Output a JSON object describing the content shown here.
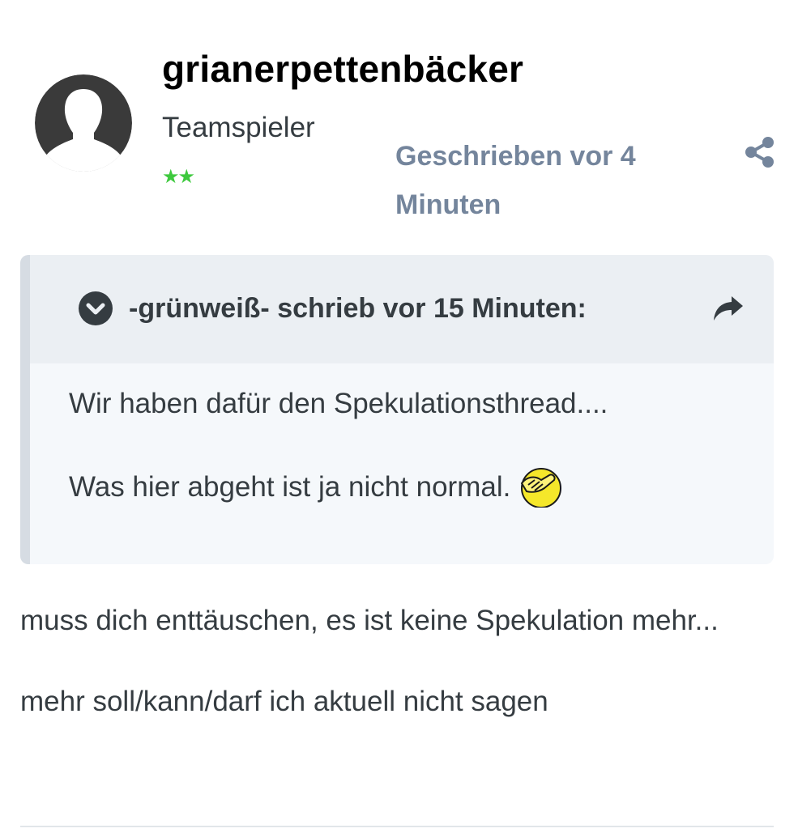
{
  "author": {
    "name": "grianerpettenbäcker",
    "rank": "Teamspieler",
    "stars": "★★",
    "avatar_icon": "user-silhouette-icon"
  },
  "post": {
    "date": "Geschrieben vor 4 Minuten",
    "share_icon": "share-icon",
    "paragraphs": [
      "muss dich enttäuschen, es ist keine Spekulation mehr...",
      "mehr soll/kann/darf ich aktuell nicht sagen"
    ]
  },
  "quote": {
    "citation": "-grünweiß- schrieb vor 15 Minuten:",
    "toggle_icon": "chevron-down-circle-icon",
    "jump_icon": "share-arrow-icon",
    "lines": [
      "Wir haben dafür den Spekulationsthread....",
      "Was hier abgeht ist ja nicht normal."
    ],
    "emoji": "facepalm-emoji"
  },
  "colors": {
    "meta": "#74859c",
    "text": "#353c41",
    "star": "#3ec93e",
    "quote_bg": "#f5f8fb",
    "quote_head_bg": "#ebeff3"
  }
}
